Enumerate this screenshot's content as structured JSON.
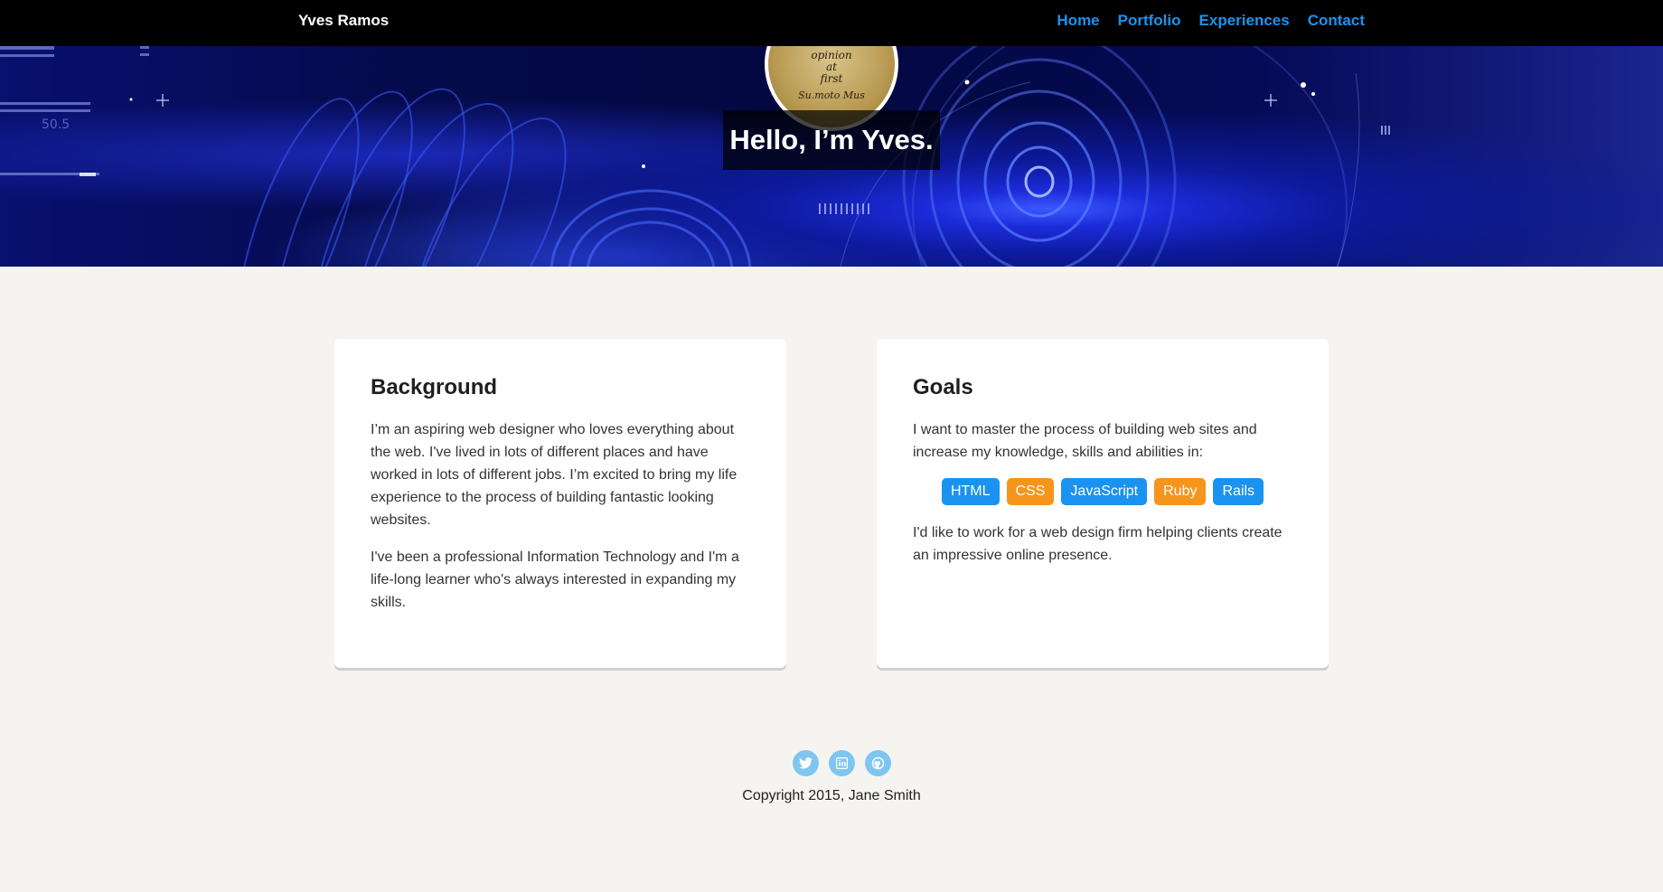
{
  "nav": {
    "brand": "Yves Ramos",
    "links": [
      "Home",
      "Portfolio",
      "Experiences",
      "Contact"
    ]
  },
  "hero": {
    "title": "Hello, I’m Yves.",
    "avatar_text": [
      "opinion",
      "at",
      "first",
      "Su.moto Mus"
    ]
  },
  "background": {
    "heading": "Background",
    "paragraphs": [
      "I’m an aspiring web designer who loves everything about the web. I've lived in lots of different places and have worked in lots of different jobs. I’m excited to bring my life experience to the process of building fantastic looking websites.",
      "I've been a professional Information Technology and I'm a life-long learner who's always interested in expanding my skills."
    ]
  },
  "goals": {
    "heading": "Goals",
    "intro": "I want to master the process of building web sites and increase my knowledge, skills and abilities in:",
    "tags": [
      {
        "label": "HTML",
        "color": "#1a93f0"
      },
      {
        "label": "CSS",
        "color": "#f6951c"
      },
      {
        "label": "JavaScript",
        "color": "#1a93f0"
      },
      {
        "label": "Ruby",
        "color": "#f6951c"
      },
      {
        "label": "Rails",
        "color": "#1a93f0"
      }
    ],
    "outro": "I'd like to work for a web design firm helping clients create an impressive online presence."
  },
  "footer": {
    "social": [
      "twitter-icon",
      "linkedin-icon",
      "github-icon"
    ],
    "copyright": "Copyright 2015, Jane Smith"
  },
  "colors": {
    "accent_blue": "#1a93f0",
    "accent_orange": "#f6951c",
    "nav_bg": "#000000",
    "page_bg": "#f5f4f0",
    "social_icon_bg": "#7ec6f0"
  }
}
